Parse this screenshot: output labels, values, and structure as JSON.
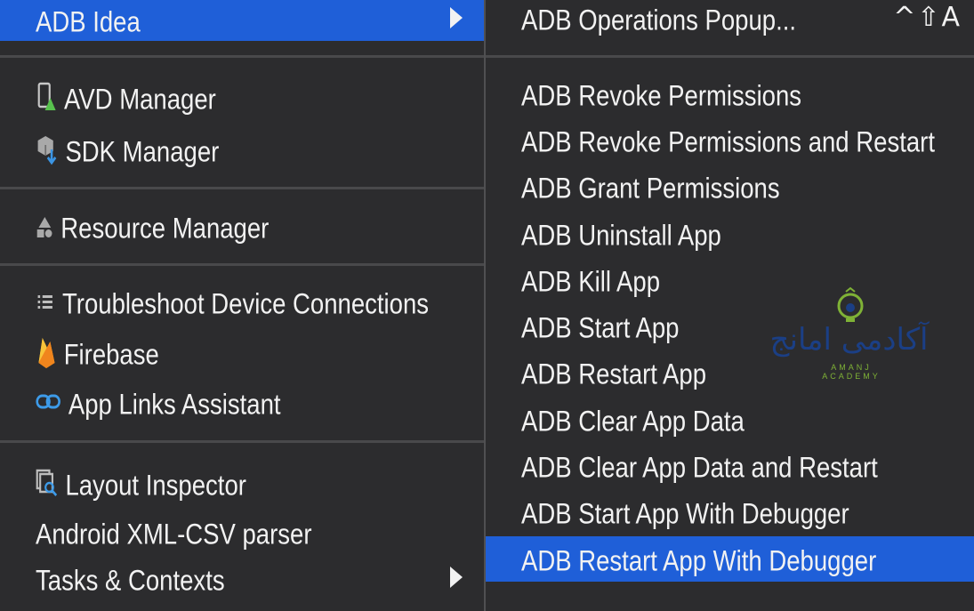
{
  "left_menu": {
    "top_item": {
      "label": "ADB Idea",
      "submenu_arrow": "chevron-right-icon"
    },
    "groups": [
      [
        {
          "icon": "avd-device-icon",
          "label": "AVD Manager"
        },
        {
          "icon": "sdk-box-icon",
          "label": "SDK Manager"
        }
      ],
      [
        {
          "icon": "resource-shapes-icon",
          "label": "Resource Manager"
        }
      ],
      [
        {
          "icon": "list-icon",
          "label": "Troubleshoot Device Connections"
        },
        {
          "icon": "firebase-flame-icon",
          "label": "Firebase"
        },
        {
          "icon": "link-icon",
          "label": "App Links Assistant"
        }
      ],
      [
        {
          "icon": "layout-inspector-icon",
          "label": "Layout Inspector"
        },
        {
          "icon": "",
          "label": "Android XML-CSV parser"
        },
        {
          "icon": "",
          "label": "Tasks & Contexts",
          "submenu_arrow": "chevron-right-icon"
        }
      ]
    ]
  },
  "right_menu": {
    "popup_item": {
      "label": "ADB Operations Popup...",
      "shortcut": "^⇧A"
    },
    "items": [
      "ADB Revoke Permissions",
      "ADB Revoke Permissions and Restart",
      "ADB Grant Permissions",
      "ADB Uninstall App",
      "ADB Kill App",
      "ADB Start App",
      "ADB Restart App",
      "ADB Clear App Data",
      "ADB Clear App Data and Restart",
      "ADB Start App With Debugger",
      "ADB Restart App With Debugger"
    ],
    "selected_index": 10
  },
  "watermark": {
    "logo": "آکادمی امانج",
    "subtitle": "AMANJ ACADEMY"
  },
  "colors": {
    "menu_bg": "#2c2c2e",
    "highlight": "#1f5fd8",
    "separator": "#49494b",
    "text": "#f2f2f2",
    "watermark_blue": "#1b3f85",
    "watermark_green": "#7fb236"
  }
}
